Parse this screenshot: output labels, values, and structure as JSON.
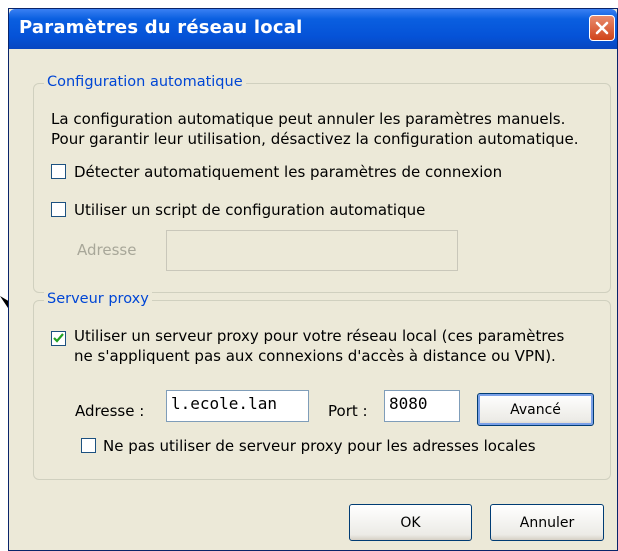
{
  "window": {
    "title": "Paramètres du réseau local"
  },
  "auto_config": {
    "legend": "Configuration automatique",
    "desc_line1": "La configuration automatique peut annuler les paramètres manuels.",
    "desc_line2": "Pour garantir leur utilisation, désactivez la configuration automatique.",
    "detect_label": "Détecter automatiquement les paramètres de connexion",
    "detect_checked": false,
    "script_label": "Utiliser un script de configuration automatique",
    "script_checked": false,
    "address_label": "Adresse",
    "address_value": ""
  },
  "proxy": {
    "legend": "Serveur proxy",
    "use_proxy_line1": "Utiliser un serveur proxy pour votre réseau local (ces paramètres",
    "use_proxy_line2": "ne s'appliquent pas aux connexions d'accès à distance ou VPN).",
    "use_proxy_checked": true,
    "address_label": "Adresse :",
    "address_value": "l.ecole.lan",
    "port_label": "Port :",
    "port_value": "8080",
    "advanced_label": "Avancé",
    "bypass_label": "Ne pas utiliser de serveur proxy pour les adresses locales",
    "bypass_checked": false
  },
  "buttons": {
    "ok": "OK",
    "cancel": "Annuler"
  },
  "colors": {
    "titlebar": "#0552d7",
    "legend": "#0046d5",
    "dialog_bg": "#ece9d8",
    "close": "#d1441a"
  }
}
